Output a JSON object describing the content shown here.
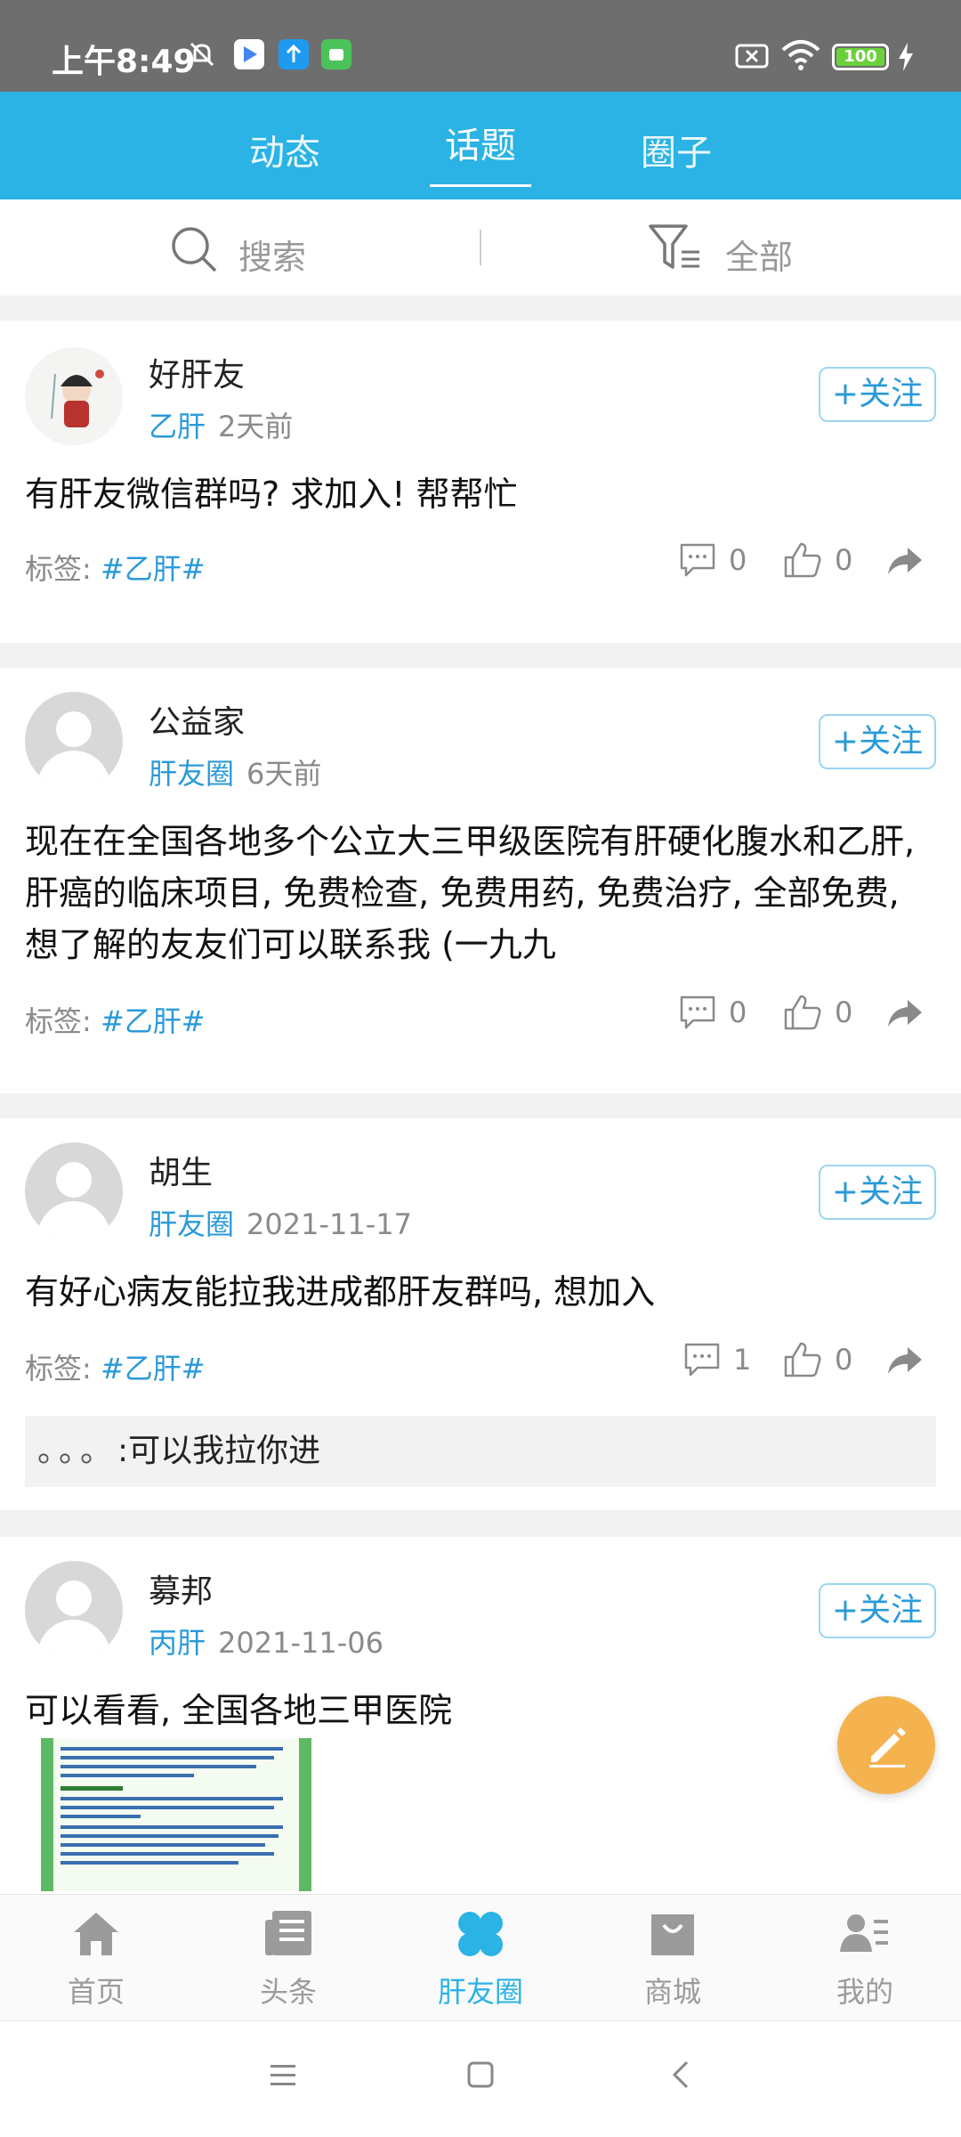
{
  "status_bar": {
    "time": "上午8:49",
    "battery": "100"
  },
  "top_tabs": [
    {
      "label": "动态"
    },
    {
      "label": "话题"
    },
    {
      "label": "圈子"
    }
  ],
  "search": {
    "label": "搜索",
    "filter_label": "全部"
  },
  "tag_prefix": "标签:",
  "follow_label": "+关注",
  "posts": [
    {
      "author": "好肝友",
      "circle": "乙肝",
      "time": "2天前",
      "content": "有肝友微信群吗? 求加入! 帮帮忙",
      "tag": "#乙肝#",
      "comments": "0",
      "likes": "0"
    },
    {
      "author": "公益家",
      "circle": "肝友圈",
      "time": "6天前",
      "content": "现在在全国各地多个公立大三甲级医院有肝硬化腹水和乙肝, 肝癌的临床项目, 免费检查, 免费用药, 免费治疗, 全部免费, 想了解的友友们可以联系我 (一九九",
      "tag": "#乙肝#",
      "comments": "0",
      "likes": "0"
    },
    {
      "author": "胡生",
      "circle": "肝友圈",
      "time": "2021-11-17",
      "content": "有好心病友能拉我进成都肝友群吗, 想加入",
      "tag": "#乙肝#",
      "comments": "1",
      "likes": "0",
      "reply": {
        "user": "。。。",
        "text": ":可以我拉你进"
      }
    },
    {
      "author": "募邦",
      "circle": "丙肝",
      "time": "2021-11-06",
      "content": "可以看看, 全国各地三甲医院"
    }
  ],
  "bottom_nav": [
    {
      "label": "首页"
    },
    {
      "label": "头条"
    },
    {
      "label": "肝友圈"
    },
    {
      "label": "商城"
    },
    {
      "label": "我的"
    }
  ],
  "colors": {
    "accent": "#2ab3e4",
    "link": "#2a9ad8",
    "fab": "#f5b350"
  }
}
